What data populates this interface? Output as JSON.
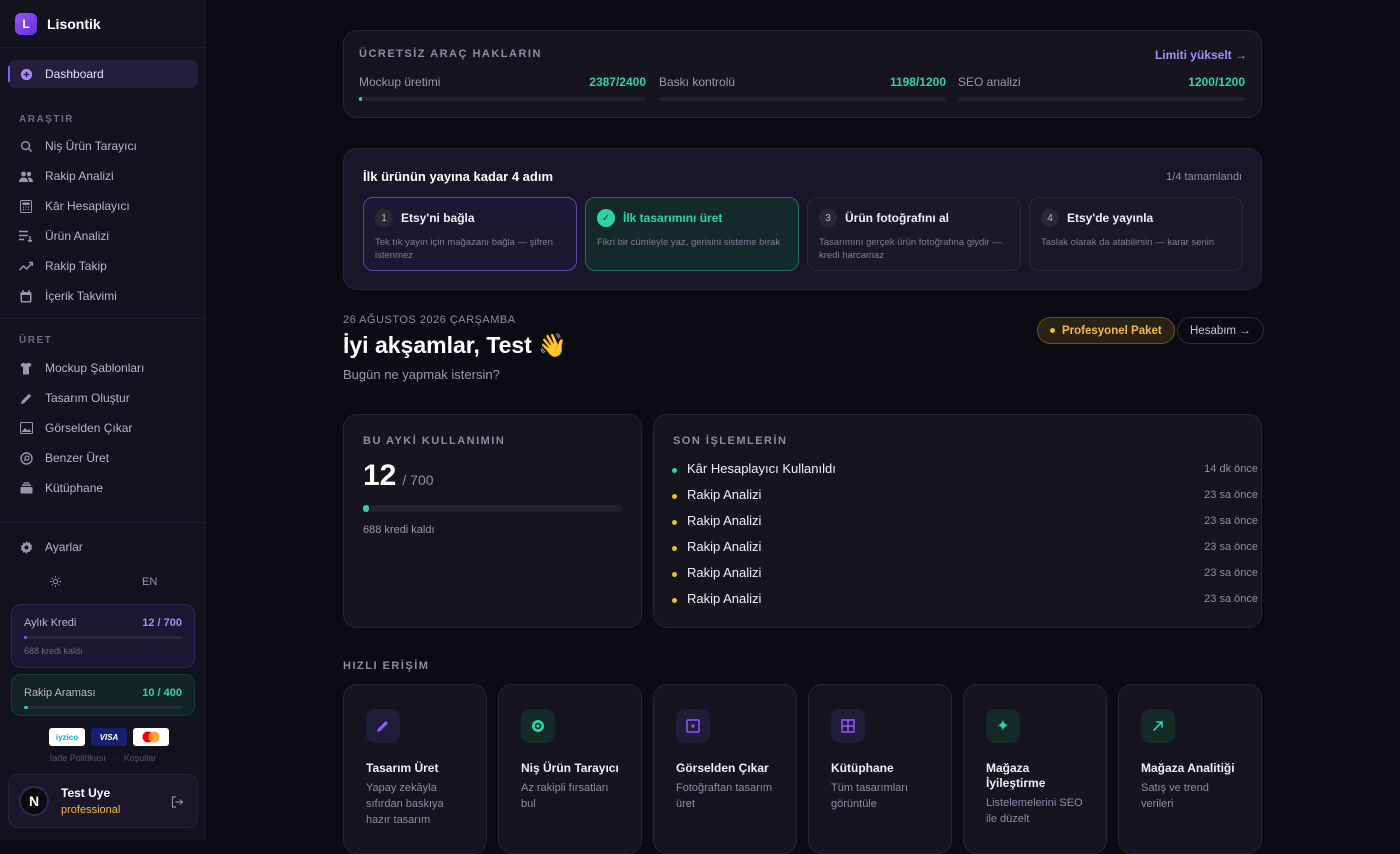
{
  "brand": {
    "logo_letter": "L",
    "name": "Lisontik"
  },
  "sidebar": {
    "dashboard": "Dashboard",
    "section_research": "ARAŞTIR",
    "research_items": [
      "Niş Ürün Tarayıcı",
      "Rakip Analizi",
      "Kâr Hesaplayıcı",
      "Ürün Analizi",
      "Rakip Takip",
      "İçerik Takvimi"
    ],
    "section_produce": "ÜRET",
    "produce_items": [
      "Mockup Şablonları",
      "Tasarım Oluştur",
      "Görselden Çıkar",
      "Benzer Üret",
      "Kütüphane"
    ],
    "settings": "Ayarlar",
    "language": "EN",
    "monthly_credit": {
      "label": "Aylık Kredi",
      "value": "12 / 700",
      "sub": "688 kredi kaldı",
      "fraction": 0.017
    },
    "competitor_search": {
      "label": "Rakip Araması",
      "value": "10 / 400",
      "fraction": 0.025
    },
    "payments": [
      "iyzico",
      "VISA"
    ],
    "legal": [
      "İade Politikası",
      "·",
      "Koşullar"
    ],
    "user": {
      "initial": "N",
      "name": "Test Uye",
      "plan": "professional"
    }
  },
  "quota": {
    "title": "ÜCRETSİZ ARAÇ HAKLARIN",
    "upgrade": "Limiti yükselt →",
    "items": [
      {
        "label": "Mockup üretimi",
        "value": "2387/2400",
        "fraction": 0.005
      },
      {
        "label": "Baskı kontrolü",
        "value": "1198/1200",
        "fraction": 0.0
      },
      {
        "label": "SEO analizi",
        "value": "1200/1200",
        "fraction": 0.0
      }
    ]
  },
  "onboarding": {
    "title": "İlk ürünün yayına kadar 4 adım",
    "progress": "1/4 tamamlandı",
    "steps": [
      {
        "num": "1",
        "title": "Etsy'ni bağla",
        "desc": "Tek tık yayın için mağazanı bağla — şifren istenmez"
      },
      {
        "num": "✓",
        "title": "İlk tasarımını üret",
        "desc": "Fikri bir cümleyle yaz, gerisini sisteme bırak"
      },
      {
        "num": "3",
        "title": "Ürün fotoğrafını al",
        "desc": "Tasarımını gerçek ürün fotoğrafına giydir — kredi harcamaz"
      },
      {
        "num": "4",
        "title": "Etsy'de yayınla",
        "desc": "Taslak olarak da atabilirsin — karar senin"
      }
    ]
  },
  "greeting": {
    "date": "26 AĞUSTOS 2026 ÇARŞAMBA",
    "title": "İyi akşamlar, Test 👋",
    "subtitle": "Bugün ne yapmak istersin?",
    "plan_pill": "Profesyonel Paket",
    "account_pill": "Hesabım →"
  },
  "usage": {
    "title": "BU AYKİ KULLANIMIN",
    "value": "12",
    "total": "/ 700",
    "remaining": "688 kredi kaldı",
    "fraction": 0.017
  },
  "recent": {
    "title": "SON İŞLEMLERİN",
    "items": [
      {
        "label": "Kâr Hesaplayıcı Kullanıldı",
        "time": "14 dk önce",
        "color": "#2dd4a8"
      },
      {
        "label": "Rakip Analizi",
        "time": "23 sa önce",
        "color": "#f5b83d"
      },
      {
        "label": "Rakip Analizi",
        "time": "23 sa önce",
        "color": "#f5b83d"
      },
      {
        "label": "Rakip Analizi",
        "time": "23 sa önce",
        "color": "#f5b83d"
      },
      {
        "label": "Rakip Analizi",
        "time": "23 sa önce",
        "color": "#f5b83d"
      },
      {
        "label": "Rakip Analizi",
        "time": "23 sa önce",
        "color": "#f5b83d"
      }
    ]
  },
  "quick_access": {
    "title": "HIZLI ERİŞİM",
    "items": [
      {
        "title": "Tasarım Üret",
        "desc": "Yapay zekâyla sıfırdan baskıya hazır tasarım",
        "icon": "pencil-icon"
      },
      {
        "title": "Niş Ürün Tarayıcı",
        "desc": "Az rakipli fırsatları bul",
        "icon": "target-icon"
      },
      {
        "title": "Görselden Çıkar",
        "desc": "Fotoğraftan tasarım üret",
        "icon": "extract-icon"
      },
      {
        "title": "Kütüphane",
        "desc": "Tüm tasarımları görüntüle",
        "icon": "grid-icon"
      },
      {
        "title": "Mağaza İyileştirme",
        "desc": "Listelemelerini SEO ile düzelt",
        "icon": "sparkle-icon"
      },
      {
        "title": "Mağaza Analitiği",
        "desc": "Satış ve trend verileri",
        "icon": "trend-icon"
      }
    ]
  },
  "colors": {
    "accent": "#8b5cf6",
    "green": "#2dd4a8",
    "amber": "#f5b83d",
    "bg": "#0c0b14"
  }
}
